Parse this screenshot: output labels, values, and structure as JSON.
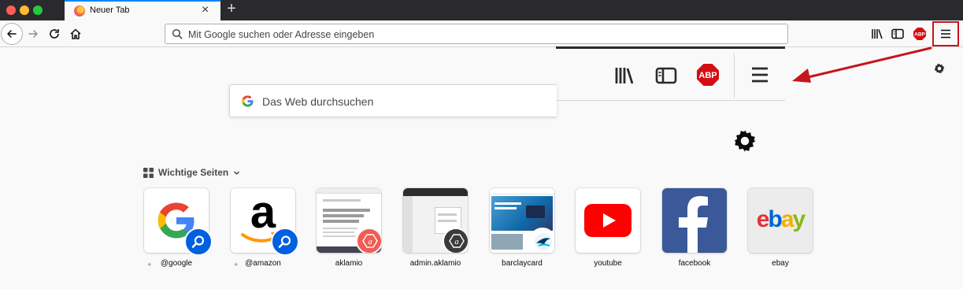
{
  "window": {
    "tab_title": "Neuer Tab",
    "tab_close": "×",
    "new_tab": "+"
  },
  "toolbar": {
    "back_icon": "arrow-left-icon",
    "forward_icon": "arrow-right-icon",
    "reload_icon": "reload-icon",
    "home_icon": "home-icon",
    "url_placeholder": "Mit Google suchen oder Adresse eingeben",
    "library_icon": "library-icon",
    "sidebar_icon": "sidebar-icon",
    "adblock_label": "ABP",
    "menu_icon": "hamburger-menu-icon"
  },
  "overlay_panel": {
    "adblock_label": "ABP",
    "arrow_color": "#c8151d"
  },
  "search": {
    "placeholder": "Das Web durchsuchen"
  },
  "top_sites": {
    "heading": "Wichtige Seiten",
    "tiles": [
      {
        "label": "@google"
      },
      {
        "label": "@amazon"
      },
      {
        "label": "aklamio"
      },
      {
        "label": "admin.aklamio"
      },
      {
        "label": "barclaycard"
      },
      {
        "label": "youtube"
      },
      {
        "label": "facebook"
      },
      {
        "label": "ebay"
      }
    ]
  },
  "colors": {
    "accent": "#0a84ff",
    "highlight_red": "#c8151d",
    "titlebar": "#2a2a2e"
  }
}
